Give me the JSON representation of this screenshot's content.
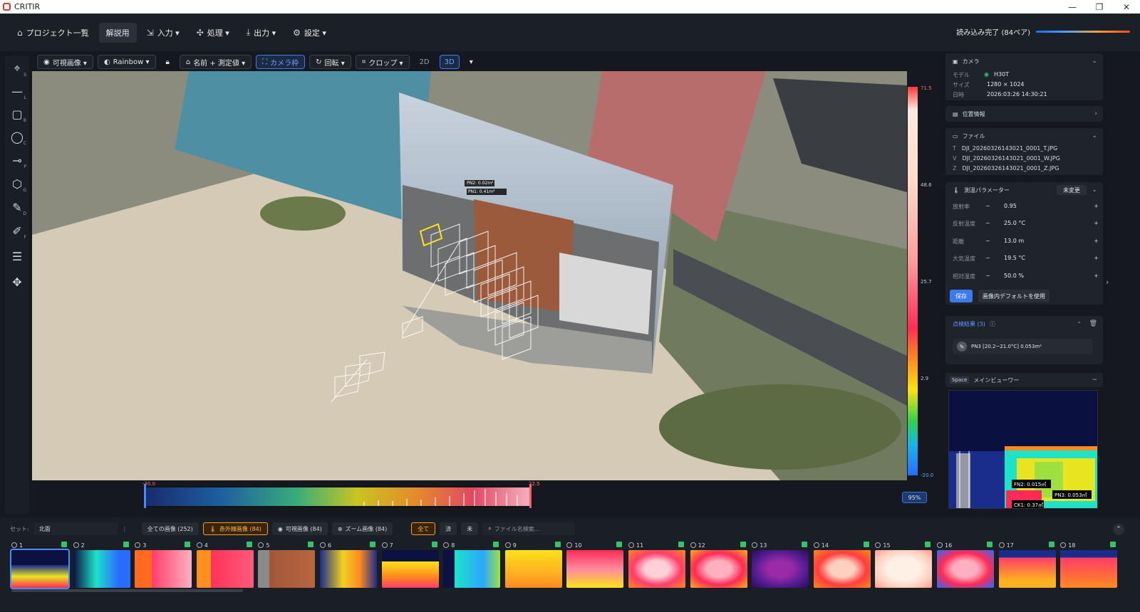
{
  "window": {
    "title": "CRITIR",
    "controls": [
      "—",
      "❐",
      "✕"
    ]
  },
  "menu": {
    "items": [
      {
        "label": "プロジェクト一覧",
        "icon": "home-icon",
        "glyph": "⌂"
      },
      {
        "label": "解説用",
        "active": true
      },
      {
        "label": "入力 ▾",
        "icon": "import-icon",
        "glyph": "⇲"
      },
      {
        "label": "処理 ▾",
        "icon": "process-icon",
        "glyph": "⚙"
      },
      {
        "label": "出力 ▾",
        "icon": "download-icon",
        "glyph": "⤓"
      },
      {
        "label": "設定 ▾",
        "icon": "settings-icon",
        "glyph": "⚙"
      }
    ],
    "load_status": "読み込み完了 (84ペア)"
  },
  "view_toolbar": {
    "visible_image": "可視画像 ▾",
    "palette": "Rainbow ▾",
    "label_mode": "名前 + 測定値 ▾",
    "camera_frame": "カメラ枠",
    "rotate": "回転 ▾",
    "crop": "クロップ ▾",
    "mode_2d": "2D",
    "mode_3d": "3D"
  },
  "left_tools": [
    {
      "icon": "crosshair-icon",
      "key": "S"
    },
    {
      "icon": "line-icon",
      "key": "L"
    },
    {
      "icon": "rectangle-icon",
      "key": "B"
    },
    {
      "icon": "circle-icon",
      "key": "C"
    },
    {
      "icon": "point-icon",
      "key": "P"
    },
    {
      "icon": "polygon-icon",
      "key": "G"
    },
    {
      "icon": "pen-icon",
      "key": "D"
    },
    {
      "icon": "edit-icon",
      "key": "F"
    },
    {
      "icon": "sliders-icon",
      "key": ""
    },
    {
      "icon": "move-icon",
      "key": ""
    }
  ],
  "colorbar": {
    "labels": [
      "71.5",
      "48.6",
      "25.7",
      "2.9",
      "-20.0"
    ]
  },
  "histogram": {
    "min": "-30.0",
    "max": "22.5"
  },
  "zoom": "95%",
  "overlay": {
    "labels": [
      "PN2: 0.02m²",
      "PN1: 0.41m²",
      "PN3: 0.05m²"
    ]
  },
  "camera_panel": {
    "title": "カメラ",
    "model_label": "モデル",
    "model": "H30T",
    "size_label": "サイズ",
    "size": "1280 × 1024",
    "date_label": "日時",
    "date": "2026:03:26 14:30:21"
  },
  "location_panel": {
    "title": "位置情報"
  },
  "file_panel": {
    "title": "ファイル",
    "files": [
      {
        "k": "T",
        "name": "DJI_20260326143021_0001_T.JPG"
      },
      {
        "k": "V",
        "name": "DJI_20260326143021_0001_W.JPG"
      },
      {
        "k": "Z",
        "name": "DJI_20260326143021_0001_Z.JPG"
      }
    ]
  },
  "params_panel": {
    "title": "測温パラメーター",
    "status": "未変更",
    "rows": [
      {
        "label": "放射率",
        "value": "0.95"
      },
      {
        "label": "反射温度",
        "value": "25.0 °C"
      },
      {
        "label": "距離",
        "value": "13.0 m"
      },
      {
        "label": "大気温度",
        "value": "19.5 °C"
      },
      {
        "label": "相対湿度",
        "value": "50.0 %"
      }
    ],
    "save": "保存",
    "use_default": "画像内デフォルトを使用"
  },
  "results_panel": {
    "title": "点検結果 (3)",
    "item": "PN3 [20.2~21.0°C] 0.053m²"
  },
  "main_viewer": {
    "key": "Space",
    "title": "メインビューワー",
    "labels": [
      "FN2: 0.015㎡",
      "PN3: 0.053㎡",
      "CK1: 0.37㎡"
    ]
  },
  "bottom": {
    "set_label": "セット:",
    "set_value": "北面",
    "filters": [
      "全ての画像 (252)",
      "赤外線画像 (84)",
      "可視画像 (84)",
      "ズーム画像 (84)"
    ],
    "status_filters": [
      "全て",
      "済",
      "未"
    ],
    "search_placeholder": "ファイル名検索...",
    "thumbs": [
      "1",
      "2",
      "3",
      "4",
      "5",
      "6",
      "7",
      "8",
      "9",
      "10",
      "11",
      "12",
      "13",
      "14",
      "15",
      "16",
      "17",
      "18"
    ]
  }
}
